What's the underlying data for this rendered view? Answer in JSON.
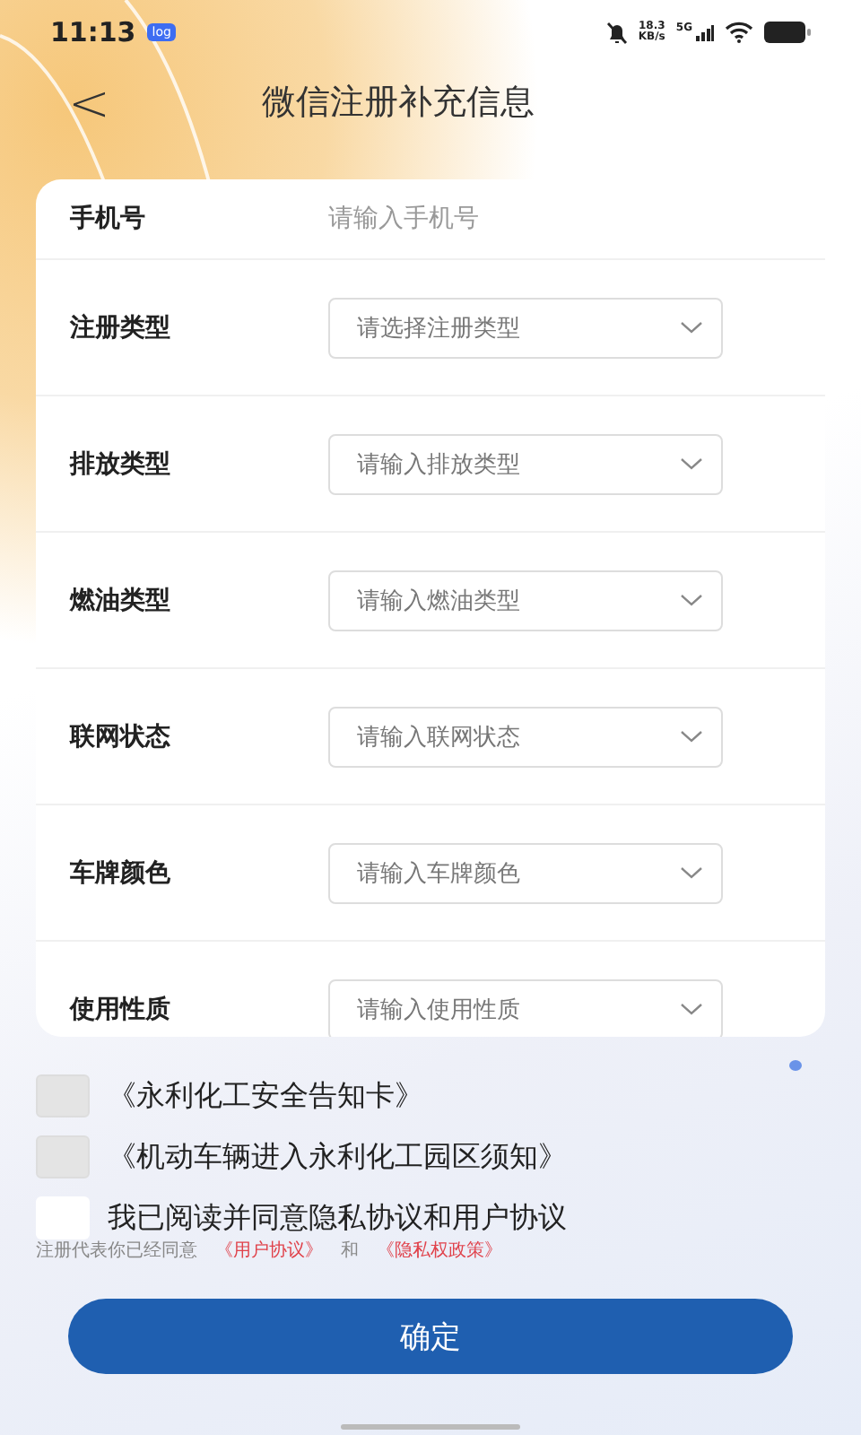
{
  "status_bar": {
    "time": "11:13",
    "badge": "log",
    "speed": "18.3\nKB/s",
    "network": "5G"
  },
  "header": {
    "back": "<",
    "title": "微信注册补充信息"
  },
  "form": {
    "phone": {
      "label": "手机号",
      "placeholder": "请输入手机号"
    },
    "selects": [
      {
        "label": "注册类型",
        "placeholder": "请选择注册类型"
      },
      {
        "label": "排放类型",
        "placeholder": "请输入排放类型"
      },
      {
        "label": "燃油类型",
        "placeholder": "请输入燃油类型"
      },
      {
        "label": "联网状态",
        "placeholder": "请输入联网状态"
      },
      {
        "label": "车牌颜色",
        "placeholder": "请输入车牌颜色"
      },
      {
        "label": "使用性质",
        "placeholder": "请输入使用性质"
      }
    ]
  },
  "agreements": [
    {
      "text": "《永利化工安全告知卡》",
      "checked": false,
      "disabled": true
    },
    {
      "text": "《机动车辆进入永利化工园区须知》",
      "checked": false,
      "disabled": true
    },
    {
      "text": "我已阅读并同意隐私协议和用户协议",
      "checked": false,
      "disabled": false
    }
  ],
  "notice": {
    "prefix": "注册代表你已经同意",
    "link1": "《用户协议》",
    "joiner": "和",
    "link2": "《隐私权政策》"
  },
  "submit": "确定"
}
